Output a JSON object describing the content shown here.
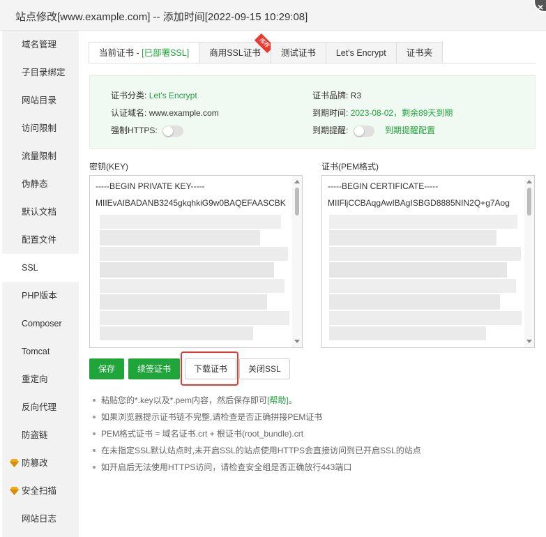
{
  "window": {
    "title": "站点修改[www.example.com] -- 添加时间[2022-09-15 10:29:08]",
    "close_glyph": "×"
  },
  "sidebar": {
    "items": [
      {
        "label": "域名管理"
      },
      {
        "label": "子目录绑定"
      },
      {
        "label": "网站目录"
      },
      {
        "label": "访问限制"
      },
      {
        "label": "流量限制"
      },
      {
        "label": "伪静态"
      },
      {
        "label": "默认文档"
      },
      {
        "label": "配置文件"
      },
      {
        "label": "SSL",
        "active": true
      },
      {
        "label": "PHP版本"
      },
      {
        "label": "Composer"
      },
      {
        "label": "Tomcat"
      },
      {
        "label": "重定向"
      },
      {
        "label": "反向代理"
      },
      {
        "label": "防盗链"
      },
      {
        "label": "防篡改",
        "icon": "diamond-icon"
      },
      {
        "label": "安全扫描",
        "icon": "diamond-icon"
      },
      {
        "label": "网站日志"
      }
    ]
  },
  "tabs": [
    {
      "label": "当前证书 - ",
      "status": "[已部署SSL]"
    },
    {
      "label": "商用SSL证书",
      "ribbon": "推荐"
    },
    {
      "label": "测试证书"
    },
    {
      "label": "Let's Encrypt"
    },
    {
      "label": "证书夹"
    }
  ],
  "cert_info": {
    "category_label": "证书分类:",
    "category_value": "Let's Encrypt",
    "brand_label": "证书品牌:",
    "brand_value": "R3",
    "domain_label": "认证域名:",
    "domain_value": "www.example.com",
    "expiry_label": "到期时间:",
    "expiry_value": "2023-08-02，剩余89天到期",
    "force_https_label": "强制HTTPS:",
    "reminder_label": "到期提醒:",
    "reminder_link": "到期提醒配置"
  },
  "key_panel": {
    "label": "密钥(KEY)",
    "line1": "-----BEGIN PRIVATE KEY-----",
    "line2": "MIIEvAIBADANB3245gkqhkiG9w0BAQEFAASCBK"
  },
  "cert_panel": {
    "label": "证书(PEM格式)",
    "line1": "-----BEGIN CERTIFICATE-----",
    "line2": "MIIFljCCBAqgAwIBAgISBGD8885NIN2Q+g7Aog"
  },
  "buttons": {
    "save": "保存",
    "renew": "续签证书",
    "download": "下载证书",
    "close_ssl": "关闭SSL"
  },
  "notes": {
    "n1_text": "粘贴您的*.key以及*.pem内容，然后保存即可",
    "n1_link": "[帮助]",
    "n1_tail": "。",
    "n2": "如果浏览器提示证书链不完整,请检查是否正确拼接PEM证书",
    "n3": "PEM格式证书 = 域名证书.crt + 根证书(root_bundle).crt",
    "n4": "在未指定SSL默认站点时,未开启SSL的站点使用HTTPS会直接访问到已开启SSL的站点",
    "n5": "如开启后无法使用HTTPS访问，请检查安全组是否正确放行443端口"
  },
  "colors": {
    "accent": "#20a53a",
    "highlight": "#e8392f"
  }
}
